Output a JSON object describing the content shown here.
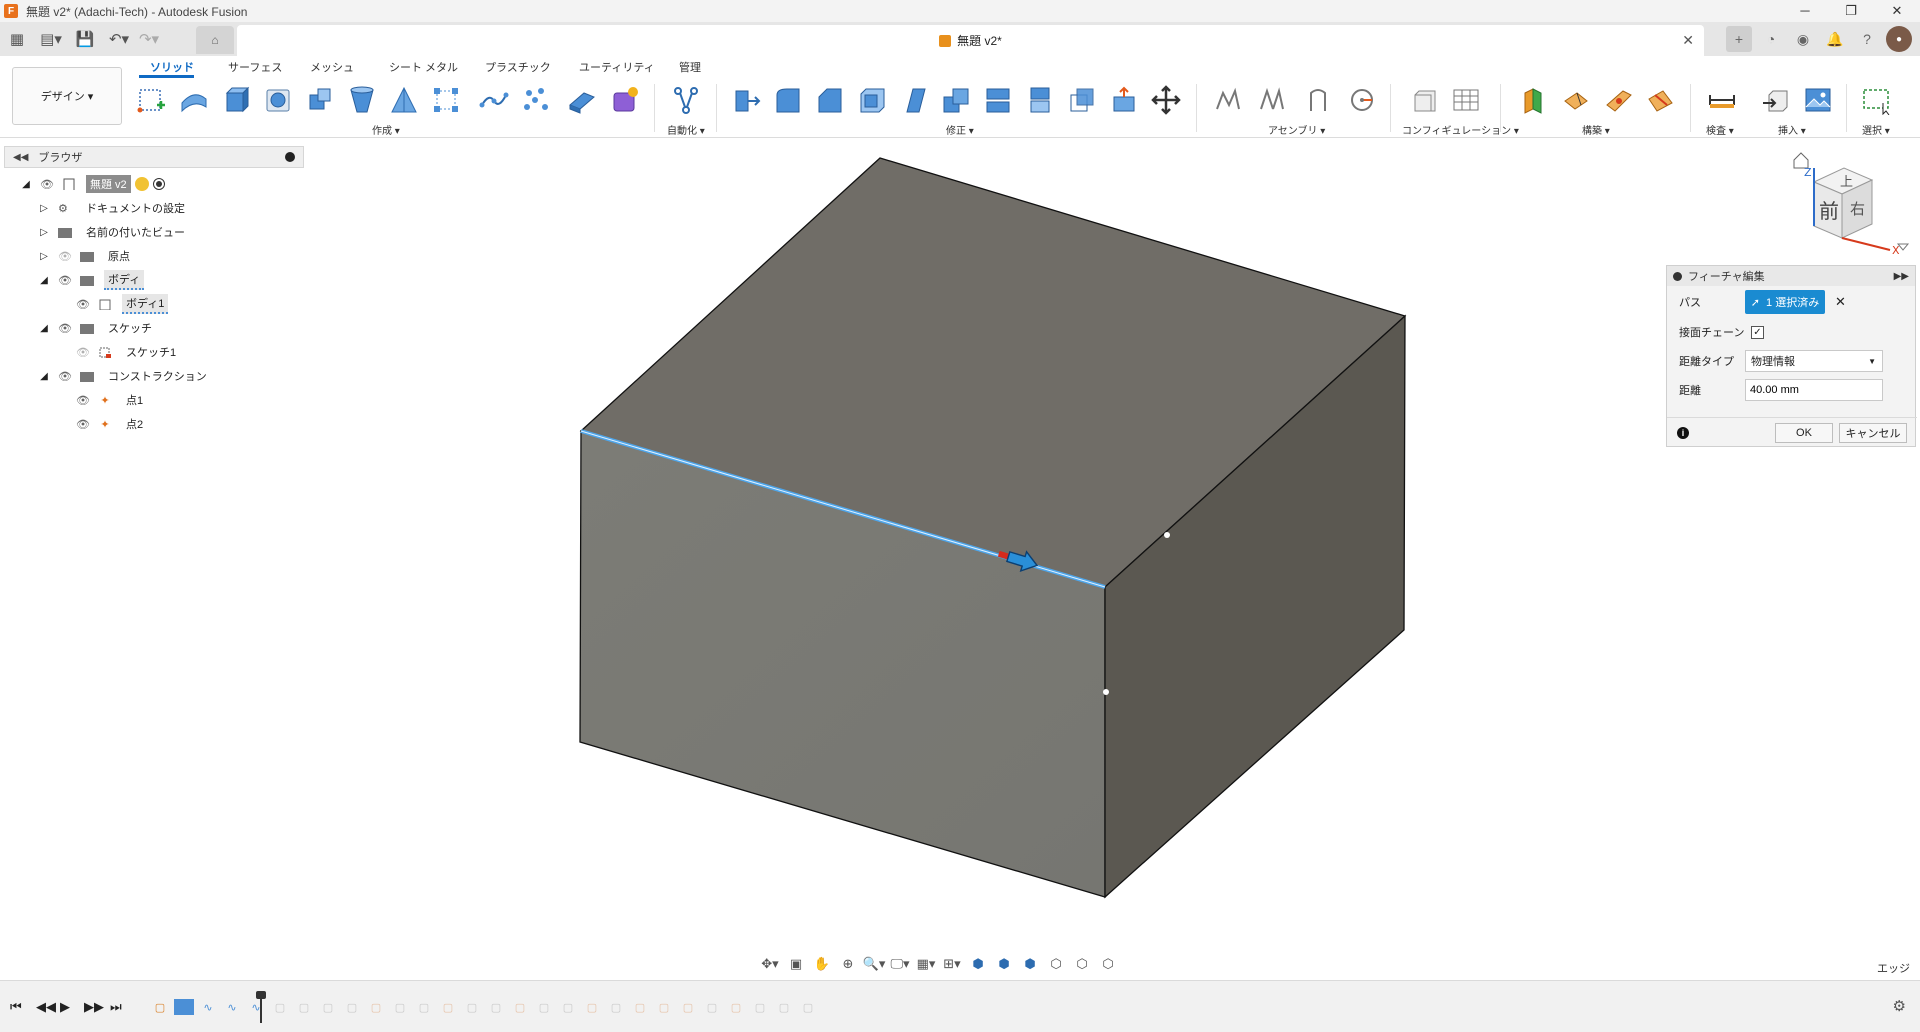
{
  "window": {
    "title": "無題 v2* (Adachi-Tech) - Autodesk Fusion",
    "app_icon_letter": "F"
  },
  "tab": {
    "doc_title": "無題 v2*"
  },
  "workspace": {
    "label": "デザイン ▾"
  },
  "ribbon": {
    "tabs": [
      "ソリッド",
      "サーフェス",
      "メッシュ",
      "シート メタル",
      "プラスチック",
      "ユーティリティ",
      "管理"
    ],
    "groups": [
      "作成 ▾",
      "自動化 ▾",
      "修正 ▾",
      "アセンブリ ▾",
      "コンフィギュレーション ▾",
      "構築 ▾",
      "検査 ▾",
      "挿入 ▾",
      "選択 ▾"
    ]
  },
  "browser": {
    "title": "ブラウザ",
    "items": [
      {
        "label": "無題 v2"
      },
      {
        "label": "ドキュメントの設定"
      },
      {
        "label": "名前の付いたビュー"
      },
      {
        "label": "原点"
      },
      {
        "label": "ボディ"
      },
      {
        "label": "ボディ1"
      },
      {
        "label": "スケッチ"
      },
      {
        "label": "スケッチ1"
      },
      {
        "label": "コンストラクション"
      },
      {
        "label": "点1"
      },
      {
        "label": "点2"
      }
    ]
  },
  "viewcube": {
    "top": "上",
    "front": "前",
    "right": "右",
    "axis_z": "Z",
    "axis_x": "X"
  },
  "dialog": {
    "title": "フィーチャ編集",
    "path_label": "パス",
    "selection_button": "1 選択済み",
    "clear_symbol": "✕",
    "tangent_chain_label": "接面チェーン",
    "tangent_chain_checked": "✓",
    "distance_type_label": "距離タイプ",
    "distance_type_value": "物理情報",
    "distance_label": "距離",
    "distance_value": "40.00 mm",
    "ok": "OK",
    "cancel": "キャンセル"
  },
  "status": {
    "selection_filter": "エッジ"
  },
  "colors": {
    "accent": "#0f6ac4",
    "selection": "#1a8bd1",
    "box_top": "#6f6c66",
    "box_front": "#7a7a74",
    "box_right": "#5a5750"
  }
}
